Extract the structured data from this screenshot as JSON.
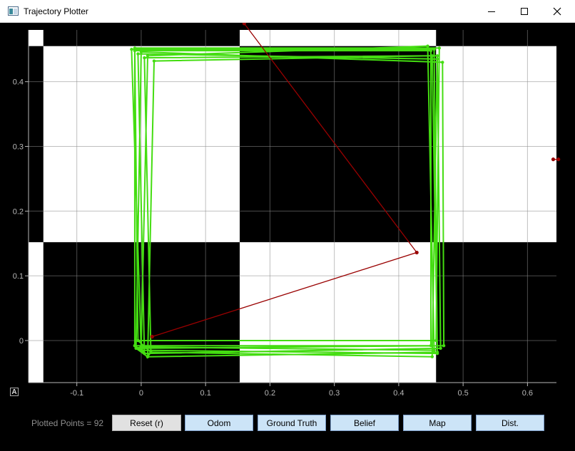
{
  "window": {
    "title": "Trajectory Plotter"
  },
  "controls": {
    "plotted_points_text": "Plotted Points = 92",
    "buttons": {
      "reset": "Reset (r)",
      "odom": "Odom",
      "ground_truth": "Ground Truth",
      "belief": "Belief",
      "map": "Map",
      "dist": "Dist."
    },
    "autorange_label": "A"
  },
  "colors": {
    "background": "#000000",
    "map_white": "#ffffff",
    "grid": "#8a8a8a",
    "axis_text": "#b8b8b8",
    "odom_trajectory": "#44dd11",
    "belief_trajectory": "#990000",
    "toggle_button": "#cce4f7",
    "reset_button": "#e1e1e1"
  },
  "chart_data": {
    "type": "line",
    "xlim": [
      -0.175,
      0.645
    ],
    "ylim": [
      -0.065,
      0.48
    ],
    "x_ticks": [
      -0.1,
      0,
      0.1,
      0.2,
      0.3,
      0.4,
      0.5,
      0.6
    ],
    "x_tick_labels": [
      "-0.1",
      "0",
      "0.1",
      "0.2",
      "0.3",
      "0.4",
      "0.5",
      "0.6"
    ],
    "y_ticks": [
      0,
      0.1,
      0.2,
      0.3,
      0.4
    ],
    "y_tick_labels": [
      "0",
      "0.1",
      "0.2",
      "0.3",
      "0.4"
    ],
    "grid": true,
    "map_white_rects": [
      [
        -0.175,
        0.455,
        -0.152,
        0.48
      ],
      [
        0.153,
        0.455,
        0.458,
        0.48
      ],
      [
        -0.152,
        0.152,
        0.153,
        0.455
      ],
      [
        0.458,
        0.152,
        0.645,
        0.455
      ],
      [
        -0.175,
        -0.065,
        -0.152,
        0.152
      ],
      [
        0.153,
        -0.065,
        0.458,
        0.152
      ]
    ],
    "series": [
      {
        "color": "#44dd11",
        "x": [
          -0.01,
          0.45,
          0.45,
          -0.01,
          -0.01,
          0.0,
          0.46,
          0.455,
          -0.015,
          0.0,
          0.005,
          0.465,
          0.46,
          -0.005,
          0.005,
          0.0,
          0.455,
          0.445,
          0.01,
          0.0,
          -0.008,
          0.47,
          0.468,
          0.0,
          -0.008,
          0.01,
          0.46,
          0.452,
          0.02,
          0.01,
          0.015,
          0.452,
          0.46,
          0.005,
          0.015,
          -0.005,
          0.458,
          0.463,
          -0.01,
          -0.005
        ],
        "y": [
          -0.008,
          -0.008,
          0.448,
          0.448,
          -0.008,
          -0.015,
          -0.02,
          0.45,
          0.45,
          -0.015,
          -0.02,
          -0.012,
          0.435,
          0.443,
          -0.02,
          -0.01,
          -0.015,
          0.455,
          0.44,
          -0.01,
          -0.012,
          -0.008,
          0.43,
          0.446,
          -0.012,
          -0.025,
          -0.018,
          0.44,
          0.432,
          -0.025,
          -0.018,
          -0.025,
          0.44,
          0.437,
          -0.018,
          0.0,
          0.0,
          0.452,
          0.452,
          0.0
        ]
      },
      {
        "color": "#990000",
        "x": [
          0.017,
          0.428,
          0.16
        ],
        "y": [
          0.006,
          0.136,
          0.49
        ]
      },
      {
        "color": "#990000",
        "x": [
          0.64,
          0.648
        ],
        "y": [
          0.28,
          0.28
        ]
      }
    ]
  }
}
